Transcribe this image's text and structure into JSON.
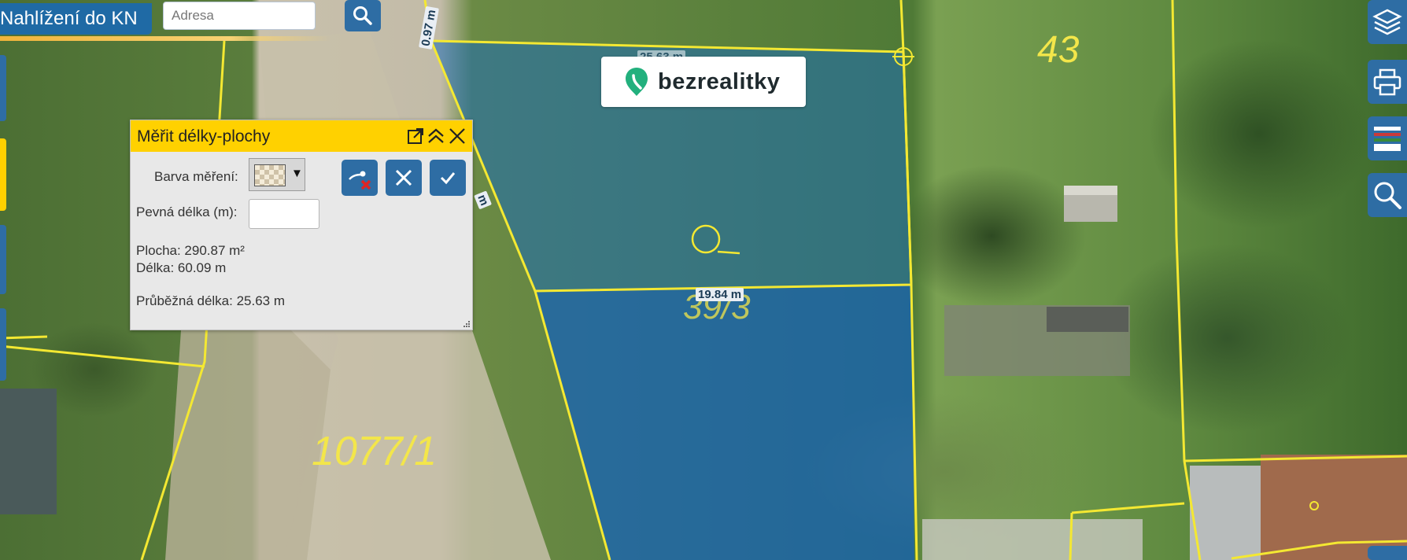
{
  "app": {
    "title": "Nahlížení do KN"
  },
  "search": {
    "placeholder": "Adresa",
    "value": "",
    "button_icon": "search-icon"
  },
  "right_toolbar": {
    "items": [
      {
        "name": "layers",
        "icon": "layers-icon"
      },
      {
        "name": "print",
        "icon": "printer-icon"
      },
      {
        "name": "legend",
        "icon": "legend-icon"
      },
      {
        "name": "zoom",
        "icon": "magnifier-icon"
      }
    ]
  },
  "logo": {
    "text": "bezrealitky",
    "brand_color": "#22b07d"
  },
  "measure_dialog": {
    "title": "Měřit délky-plochy",
    "color_label": "Barva měření:",
    "fixed_length_label": "Pevná délka (m):",
    "fixed_length_value": "",
    "area_text": "Plocha: 290.87 m²",
    "length_text": "Délka: 60.09 m",
    "running_length_text": "Průběžná délka: 25.63 m",
    "header_color": "#ffd100",
    "buttons": [
      {
        "name": "remove-point",
        "icon": "remove-point-icon"
      },
      {
        "name": "cancel",
        "icon": "close-icon"
      },
      {
        "name": "confirm",
        "icon": "check-icon"
      }
    ]
  },
  "map": {
    "parcel_labels": [
      "43",
      "1077/1",
      "39/3"
    ],
    "edge_labels": [
      "0.97 m",
      "25.63 m",
      "19.84 m",
      "m"
    ],
    "boundary_color": "#f4e832",
    "measurement_fill": "#1b6bb5"
  }
}
